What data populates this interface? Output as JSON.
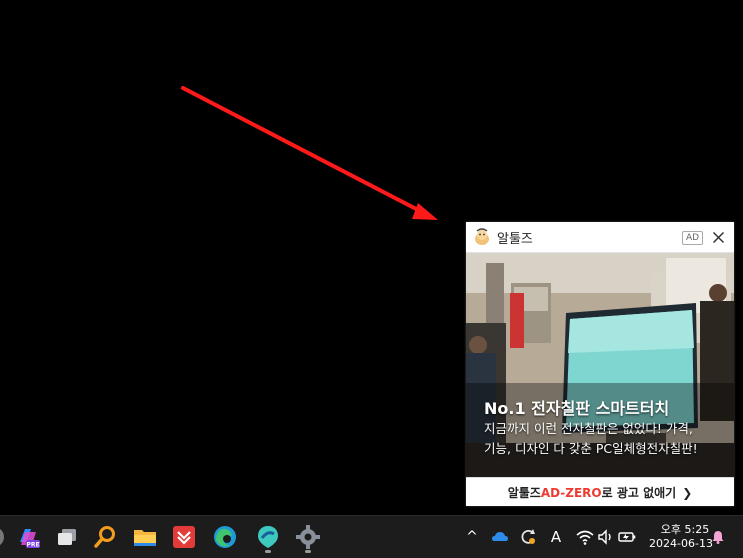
{
  "ad": {
    "brand": "알툴즈",
    "badge": "AD",
    "headline": "No.1 전자칠판 스마트터치",
    "subline1": "지금까지 이런 전자칠판은 없었다! 가격,",
    "subline2": "기능, 디자인 다 갖춘 PC일체형전자칠판!",
    "footer_prefix": "알툴즈 ",
    "footer_highlight": "AD-ZERO",
    "footer_suffix": "로 광고 없애기",
    "footer_chevron": "❯"
  },
  "colors": {
    "arrow": "#ff1a1a",
    "highlight": "#ee3b31",
    "taskbar": "#1c1c1c"
  },
  "taskbar": {
    "apps": [
      {
        "name": "copilot-icon"
      },
      {
        "name": "task-view-icon"
      },
      {
        "name": "search-magnifier-icon"
      },
      {
        "name": "file-explorer-icon"
      },
      {
        "name": "red-app-icon"
      },
      {
        "name": "edge-icon"
      },
      {
        "name": "maps-app-icon"
      },
      {
        "name": "settings-gear-icon"
      }
    ],
    "tray": {
      "chevron": "^",
      "ime": "A"
    },
    "clock": {
      "time": "오후 5:25",
      "date": "2024-06-13"
    }
  }
}
